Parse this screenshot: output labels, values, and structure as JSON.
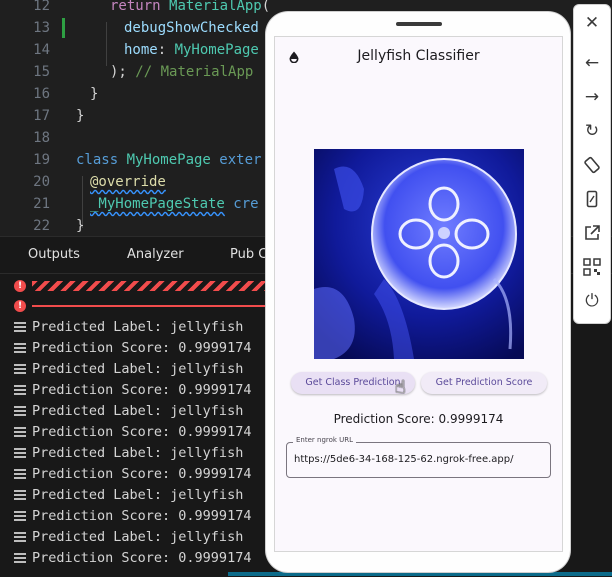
{
  "editor": {
    "lines": [
      {
        "num": "12",
        "parts": [
          [
            "kw",
            "return "
          ],
          [
            "cls",
            "MaterialApp"
          ],
          [
            "txt",
            "("
          ]
        ]
      },
      {
        "num": "13",
        "parts": [
          [
            "prop",
            "debugShowChecked"
          ]
        ]
      },
      {
        "num": "14",
        "parts": [
          [
            "prop",
            "home"
          ],
          [
            "txt",
            ": "
          ],
          [
            "cls",
            "MyHomePage"
          ]
        ]
      },
      {
        "num": "15",
        "parts": [
          [
            "txt",
            "); "
          ],
          [
            "cm",
            "// MaterialApp"
          ]
        ]
      },
      {
        "num": "16",
        "parts": [
          [
            "txt",
            "}"
          ]
        ]
      },
      {
        "num": "17",
        "parts": [
          [
            "txt",
            "}"
          ]
        ]
      },
      {
        "num": "18",
        "parts": []
      },
      {
        "num": "19",
        "parts": [
          [
            "kw2",
            "class "
          ],
          [
            "cls",
            "MyHomePage"
          ],
          [
            "kw2",
            " exter"
          ]
        ]
      },
      {
        "num": "20",
        "parts": [
          [
            "ann",
            "@override"
          ]
        ]
      },
      {
        "num": "21",
        "parts": [
          [
            "fn",
            "_MyHomePageState"
          ],
          [
            "kw2",
            " cre"
          ]
        ]
      },
      {
        "num": "22",
        "parts": [
          [
            "txt",
            "}"
          ]
        ]
      }
    ]
  },
  "panel": {
    "tabs": [
      "Outputs",
      "Analyzer",
      "Pub C"
    ],
    "log": [
      "Predicted Label: jellyfish",
      "Prediction Score: 0.9999174",
      "Predicted Label: jellyfish",
      "Prediction Score: 0.9999174",
      "Predicted Label: jellyfish",
      "Prediction Score: 0.9999174",
      "Predicted Label: jellyfish",
      "Prediction Score: 0.9999174",
      "Predicted Label: jellyfish",
      "Prediction Score: 0.9999174",
      "Predicted Label: jellyfish",
      "Prediction Score: 0.9999174"
    ]
  },
  "app": {
    "title": "Jellyfish Classifier",
    "btn_class": "Get Class Prediction",
    "btn_score": "Get Prediction Score",
    "score_text": "Prediction Score: 0.9999174",
    "url_label": "Enter ngrok URL",
    "url_value": "https://5de6-34-168-125-62.ngrok-free.app/"
  },
  "toolbar": {
    "icons": [
      "close-icon",
      "back-icon",
      "forward-icon",
      "rotate-icon",
      "rotate-device-icon",
      "device-icon",
      "open-external-icon",
      "qr-code-icon",
      "power-icon"
    ]
  },
  "colors": {
    "accent": "#5b4a9a",
    "error": "#f14c4c",
    "editor_bg": "#1f1f1f"
  }
}
